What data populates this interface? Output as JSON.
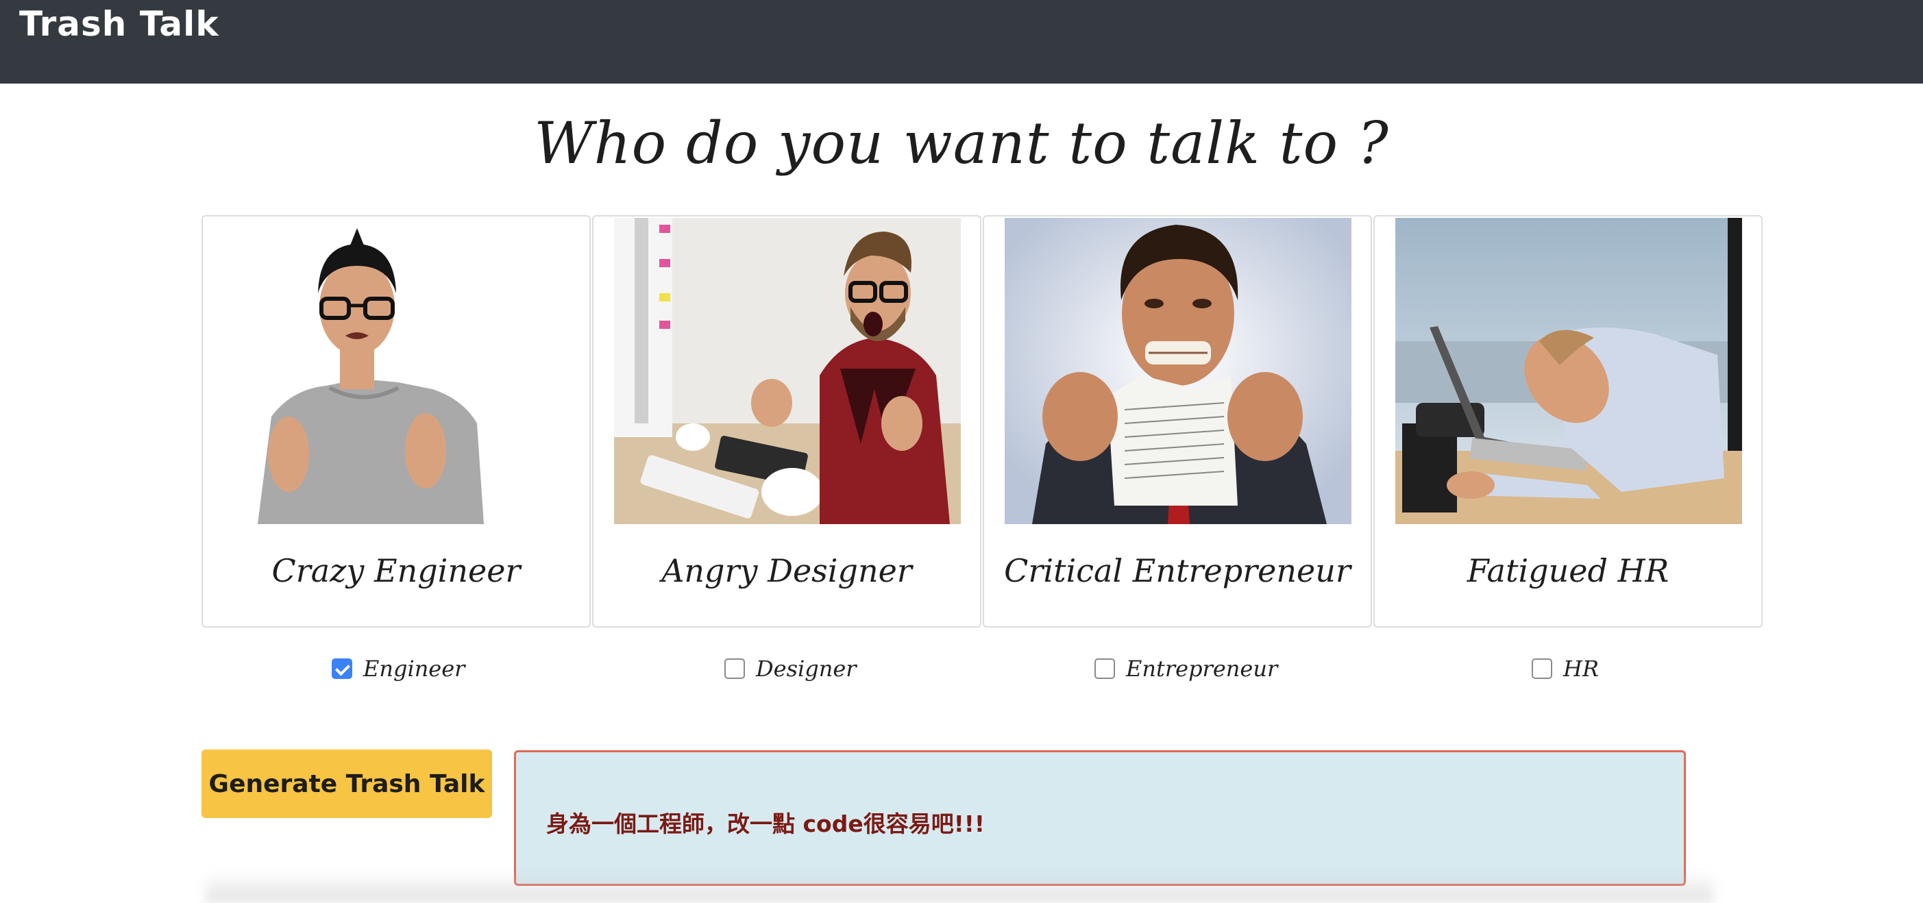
{
  "app": {
    "brand": "Trash Talk"
  },
  "heading": "Who do you want to talk to ?",
  "cards": [
    {
      "title": "Crazy Engineer",
      "image": "frustrated-engineer-photo"
    },
    {
      "title": "Angry Designer",
      "image": "angry-designer-photo"
    },
    {
      "title": "Critical Entrepreneur",
      "image": "paper-tearing-entrepreneur-photo"
    },
    {
      "title": "Fatigued HR",
      "image": "sleeping-hr-photo"
    }
  ],
  "options": [
    {
      "label": "Engineer",
      "checked": true
    },
    {
      "label": "Designer",
      "checked": false
    },
    {
      "label": "Entrepreneur",
      "checked": false
    },
    {
      "label": "HR",
      "checked": false
    }
  ],
  "generate_button": "Generate Trash Talk",
  "result_text": "身為一個工程師，改一點 code很容易吧!!!",
  "colors": {
    "navbar": "#343a40",
    "button": "#f7c443",
    "result_bg": "#d7eaf0",
    "result_border": "#e06a55",
    "result_text": "#7a1a14",
    "checkbox_checked": "#3b82f6"
  }
}
